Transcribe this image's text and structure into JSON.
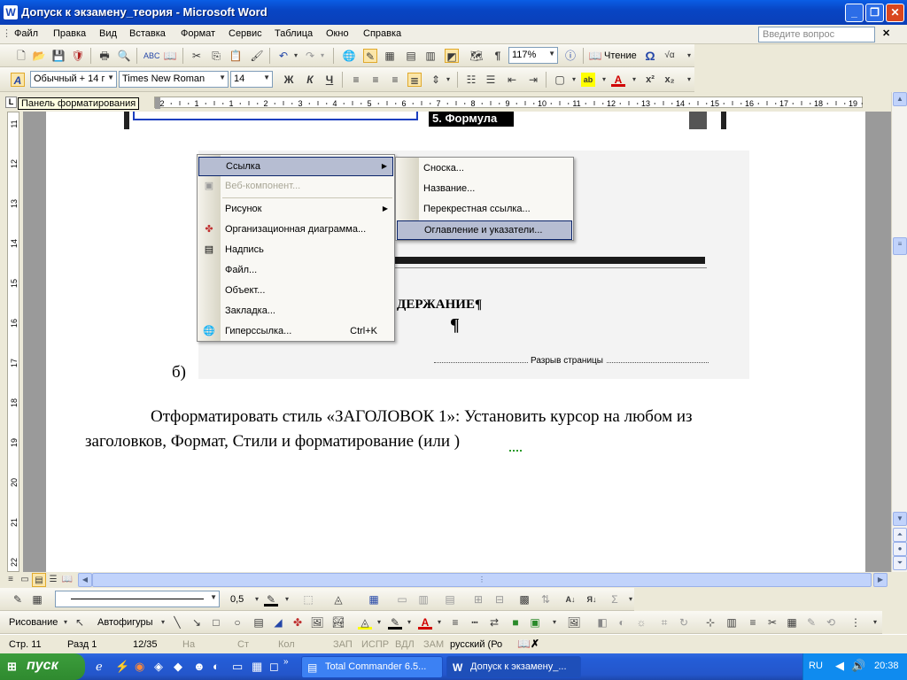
{
  "window": {
    "title": "Допуск к экзамену_теория - Microsoft Word",
    "app_icon": "W"
  },
  "menubar": {
    "items": [
      "Файл",
      "Правка",
      "Вид",
      "Вставка",
      "Формат",
      "Сервис",
      "Таблица",
      "Окно",
      "Справка"
    ],
    "ask_placeholder": "Введите вопрос"
  },
  "std_toolbar": {
    "zoom": "117%",
    "reading_label": "Чтение"
  },
  "fmt_toolbar": {
    "style": "Обычный + 14 г",
    "font": "Times New Roman",
    "size": "14"
  },
  "ruler": {
    "tooltip": "Панель форматирования",
    "hnumbers": [
      "2",
      "1",
      "1",
      "2",
      "3",
      "4",
      "5",
      "6",
      "7",
      "8",
      "9",
      "10",
      "11",
      "12",
      "13",
      "14",
      "15",
      "16",
      "17",
      "18",
      "19"
    ],
    "vnumbers": [
      "11",
      "12",
      "13",
      "14",
      "15",
      "16",
      "17",
      "18",
      "19",
      "20",
      "21",
      "22"
    ]
  },
  "doc": {
    "frame_text": "5. Формула",
    "heading": "ДЕРЖАНИЕ¶",
    "pilcrow": "¶",
    "marker": "б)",
    "page_break": "Разрыв страницы",
    "para_line1": "Отформатировать стиль «ЗАГОЛОВОК 1»: Установить курсор на любом из",
    "para_line2": "заголовков, Формат, Стили и форматирование (или )"
  },
  "insert_menu": {
    "items": [
      {
        "label": "Ссылка",
        "submenu": true,
        "selected": true
      },
      {
        "label": "Веб-компонент...",
        "disabled": true
      },
      {
        "label": "Рисунок",
        "submenu": true
      },
      {
        "label": "Организационная диаграмма..."
      },
      {
        "label": "Надпись"
      },
      {
        "label": "Файл..."
      },
      {
        "label": "Объект..."
      },
      {
        "label": "Закладка..."
      },
      {
        "label": "Гиперссылка...",
        "shortcut": "Ctrl+K"
      }
    ]
  },
  "ref_submenu": {
    "items": [
      "Сноска...",
      "Название...",
      "Перекрестная ссылка...",
      "Оглавление и указатели..."
    ],
    "selected_index": 3
  },
  "drawing_toolbar": {
    "line_width": "0,5",
    "draw_label": "Рисование",
    "autoshapes_label": "Автофигуры"
  },
  "statusbar": {
    "page": "Стр. 11",
    "section": "Разд 1",
    "pages": "12/35",
    "at": "На",
    "line": "Ст",
    "col": "Кол",
    "rec": "ЗАП",
    "trk": "ИСПР",
    "ext": "ВДЛ",
    "ovr": "ЗАМ",
    "lang": "русский (Ро"
  },
  "taskbar": {
    "start": "пуск",
    "tasks": [
      "Total Commander 6.5...",
      "Допуск к экзамену_..."
    ],
    "lang": "RU",
    "time": "20:38"
  }
}
